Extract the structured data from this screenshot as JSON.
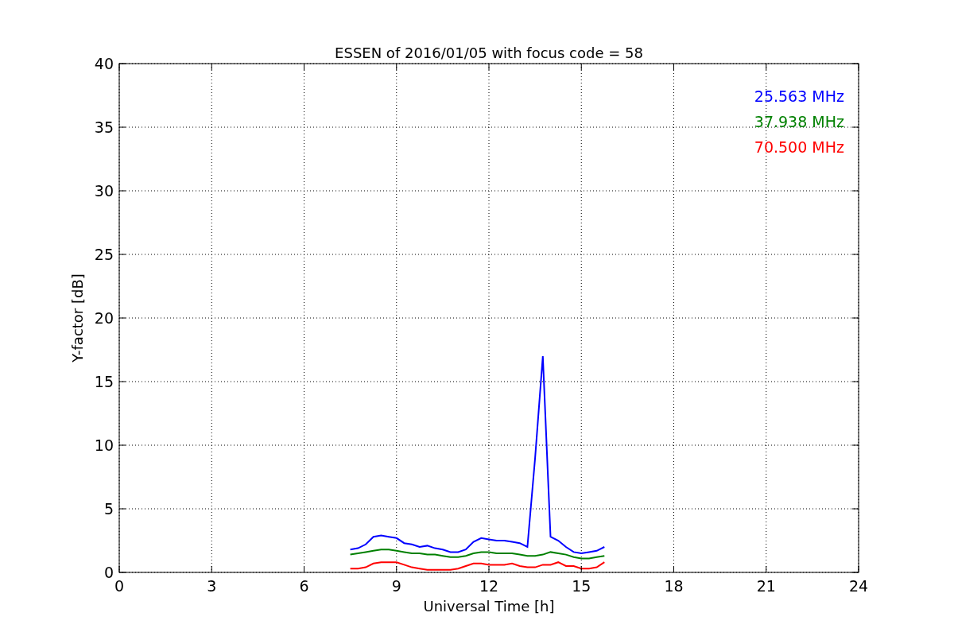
{
  "figure": {
    "chart_data": {
      "type": "line",
      "title": "ESSEN of 2016/01/05 with focus code = 58",
      "xlabel": "Universal Time [h]",
      "ylabel": "Y-factor [dB]",
      "x": [
        7.5,
        7.75,
        8.0,
        8.25,
        8.5,
        8.75,
        9.0,
        9.25,
        9.5,
        9.75,
        10.0,
        10.25,
        10.5,
        10.75,
        11.0,
        11.25,
        11.5,
        11.75,
        12.0,
        12.25,
        12.5,
        12.75,
        13.0,
        13.25,
        13.5,
        13.75,
        14.0,
        14.25,
        14.5,
        14.75,
        15.0,
        15.25,
        15.5,
        15.75
      ],
      "series": [
        {
          "name": "25.563 MHz",
          "color": "#0000ff",
          "values": [
            1.8,
            1.9,
            2.2,
            2.8,
            2.9,
            2.8,
            2.7,
            2.3,
            2.2,
            2.0,
            2.1,
            1.9,
            1.8,
            1.6,
            1.6,
            1.8,
            2.4,
            2.7,
            2.6,
            2.5,
            2.5,
            2.4,
            2.3,
            2.0,
            9.0,
            17.0,
            2.8,
            2.5,
            2.0,
            1.6,
            1.5,
            1.6,
            1.7,
            2.0
          ]
        },
        {
          "name": "37.938 MHz",
          "color": "#008000",
          "values": [
            1.4,
            1.5,
            1.6,
            1.7,
            1.8,
            1.8,
            1.7,
            1.6,
            1.5,
            1.5,
            1.4,
            1.4,
            1.3,
            1.2,
            1.2,
            1.3,
            1.5,
            1.6,
            1.6,
            1.5,
            1.5,
            1.5,
            1.4,
            1.3,
            1.3,
            1.4,
            1.6,
            1.5,
            1.4,
            1.2,
            1.1,
            1.1,
            1.2,
            1.3
          ]
        },
        {
          "name": "70.500 MHz",
          "color": "#ff0000",
          "values": [
            0.3,
            0.3,
            0.4,
            0.7,
            0.8,
            0.8,
            0.8,
            0.6,
            0.4,
            0.3,
            0.2,
            0.2,
            0.2,
            0.2,
            0.3,
            0.5,
            0.7,
            0.7,
            0.6,
            0.6,
            0.6,
            0.7,
            0.5,
            0.4,
            0.4,
            0.6,
            0.6,
            0.8,
            0.5,
            0.5,
            0.3,
            0.3,
            0.4,
            0.8
          ]
        }
      ],
      "xlim": [
        0,
        24
      ],
      "ylim": [
        0,
        40
      ],
      "xticks": [
        0,
        3,
        6,
        9,
        12,
        15,
        18,
        21,
        24
      ],
      "yticks": [
        0,
        5,
        10,
        15,
        20,
        25,
        30,
        35,
        40
      ],
      "grid": true
    }
  }
}
